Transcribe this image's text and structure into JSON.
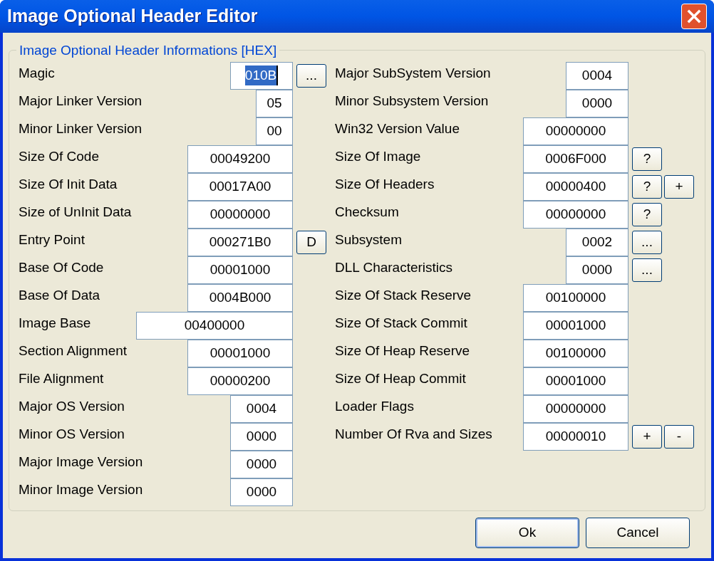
{
  "window": {
    "title": "Image Optional Header Editor"
  },
  "group": {
    "legend": "Image Optional Header Informations [HEX]"
  },
  "left_fields": [
    {
      "label": "Magic",
      "value": "010B",
      "kind": "word",
      "selected": true,
      "buttons": [
        "..."
      ]
    },
    {
      "label": "Major Linker Version",
      "value": "05",
      "kind": "byte",
      "selected": false
    },
    {
      "label": "Minor Linker Version",
      "value": "00",
      "kind": "byte",
      "selected": false
    },
    {
      "label": "Size Of Code",
      "value": "00049200",
      "kind": "dword",
      "selected": false
    },
    {
      "label": "Size Of Init Data",
      "value": "00017A00",
      "kind": "dword",
      "selected": false
    },
    {
      "label": "Size of UnInit Data",
      "value": "00000000",
      "kind": "dword",
      "selected": false
    },
    {
      "label": "Entry Point",
      "value": "000271B0",
      "kind": "dword",
      "selected": false,
      "buttons": [
        "D"
      ]
    },
    {
      "label": "Base Of Code",
      "value": "00001000",
      "kind": "dword",
      "selected": false
    },
    {
      "label": "Base Of Data",
      "value": "0004B000",
      "kind": "dword",
      "selected": false
    },
    {
      "label": "Image Base",
      "value": "00400000",
      "kind": "wide",
      "selected": false
    },
    {
      "label": "Section Alignment",
      "value": "00001000",
      "kind": "dword",
      "selected": false
    },
    {
      "label": "File Alignment",
      "value": "00000200",
      "kind": "dword",
      "selected": false
    },
    {
      "label": "Major OS Version",
      "value": "0004",
      "kind": "word",
      "selected": false
    },
    {
      "label": "Minor OS Version",
      "value": "0000",
      "kind": "word",
      "selected": false
    },
    {
      "label": "Major Image Version",
      "value": "0000",
      "kind": "word",
      "selected": false
    },
    {
      "label": "Minor Image Version",
      "value": "0000",
      "kind": "word",
      "selected": false
    }
  ],
  "right_fields": [
    {
      "label": "Major SubSystem Version",
      "value": "0004",
      "kind": "word",
      "selected": false
    },
    {
      "label": "Minor Subsystem Version",
      "value": "0000",
      "kind": "word",
      "selected": false
    },
    {
      "label": "Win32 Version Value",
      "value": "00000000",
      "kind": "dword",
      "selected": false
    },
    {
      "label": "Size Of Image",
      "value": "0006F000",
      "kind": "dword",
      "selected": false,
      "buttons": [
        "?"
      ]
    },
    {
      "label": "Size Of Headers",
      "value": "00000400",
      "kind": "dword",
      "selected": false,
      "buttons": [
        "?",
        "+"
      ]
    },
    {
      "label": "Checksum",
      "value": "00000000",
      "kind": "dword",
      "selected": false,
      "buttons": [
        "?"
      ]
    },
    {
      "label": "Subsystem",
      "value": "0002",
      "kind": "word",
      "selected": false,
      "buttons": [
        "..."
      ]
    },
    {
      "label": "DLL Characteristics",
      "value": "0000",
      "kind": "word",
      "selected": false,
      "buttons": [
        "..."
      ]
    },
    {
      "label": "Size Of Stack Reserve",
      "value": "00100000",
      "kind": "dword",
      "selected": false
    },
    {
      "label": "Size Of Stack Commit",
      "value": "00001000",
      "kind": "dword",
      "selected": false
    },
    {
      "label": "Size Of Heap Reserve",
      "value": "00100000",
      "kind": "dword",
      "selected": false
    },
    {
      "label": "Size Of Heap Commit",
      "value": "00001000",
      "kind": "dword",
      "selected": false
    },
    {
      "label": "Loader Flags",
      "value": "00000000",
      "kind": "dword",
      "selected": false
    },
    {
      "label": "Number Of Rva and Sizes",
      "value": "00000010",
      "kind": "dword",
      "selected": false,
      "buttons": [
        "+",
        "-"
      ]
    }
  ],
  "buttons": [
    {
      "label": "Ok",
      "default": true
    },
    {
      "label": "Cancel",
      "default": false
    }
  ]
}
